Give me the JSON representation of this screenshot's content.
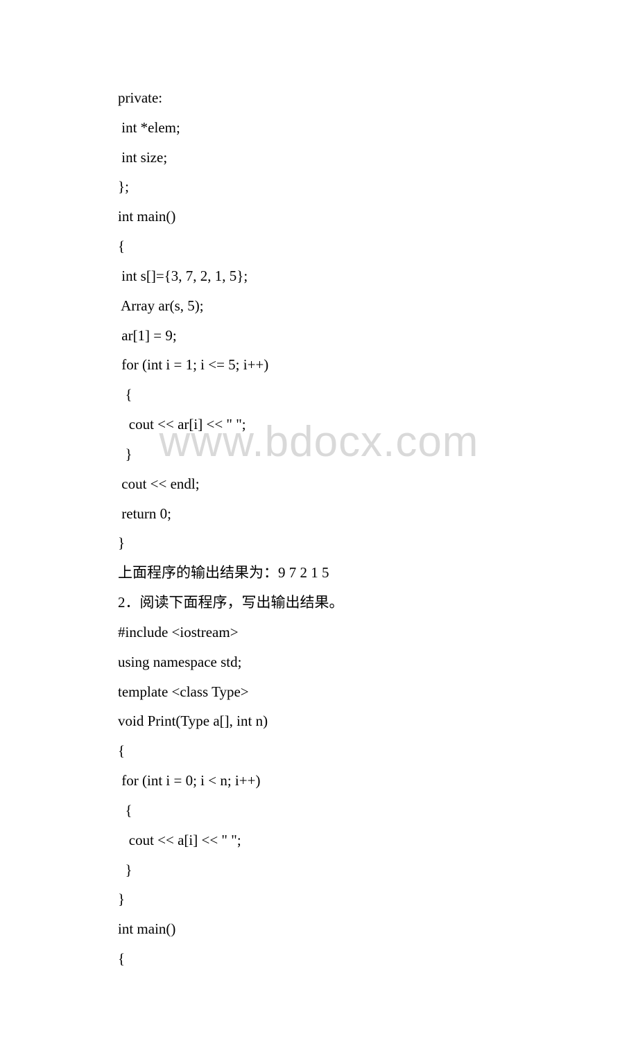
{
  "watermark": "www.bdocx.com",
  "lines": [
    {
      "text": "private:",
      "cjk": false
    },
    {
      "text": " int *elem;",
      "cjk": false
    },
    {
      "text": " int size;",
      "cjk": false
    },
    {
      "text": "};",
      "cjk": false
    },
    {
      "text": "int main()",
      "cjk": false
    },
    {
      "text": "{",
      "cjk": false
    },
    {
      "text": " int s[]={3, 7, 2, 1, 5};",
      "cjk": false
    },
    {
      "text": " Array ar(s, 5);",
      "cjk": false
    },
    {
      "text": " ar[1] = 9;",
      "cjk": false
    },
    {
      "text": " for (int i = 1; i <= 5; i++)",
      "cjk": false
    },
    {
      "text": "  {",
      "cjk": false
    },
    {
      "text": "   cout << ar[i] << \" \";",
      "cjk": false
    },
    {
      "text": "  }",
      "cjk": false
    },
    {
      "text": " cout << endl;",
      "cjk": false
    },
    {
      "text": " return 0;",
      "cjk": false
    },
    {
      "text": "}",
      "cjk": false
    },
    {
      "text": "上面程序的输出结果为：9 7 2 1 5",
      "cjk": true
    },
    {
      "text": "2．阅读下面程序，写出输出结果。",
      "cjk": true
    },
    {
      "text": "#include <iostream>",
      "cjk": false
    },
    {
      "text": "using namespace std;",
      "cjk": false
    },
    {
      "text": "template <class Type>",
      "cjk": false
    },
    {
      "text": "void Print(Type a[], int n)",
      "cjk": false
    },
    {
      "text": "{",
      "cjk": false
    },
    {
      "text": " for (int i = 0; i < n; i++)",
      "cjk": false
    },
    {
      "text": "  {",
      "cjk": false
    },
    {
      "text": "   cout << a[i] << \" \";",
      "cjk": false
    },
    {
      "text": "  }",
      "cjk": false
    },
    {
      "text": "}",
      "cjk": false
    },
    {
      "text": "int main()",
      "cjk": false
    },
    {
      "text": "{",
      "cjk": false
    }
  ]
}
